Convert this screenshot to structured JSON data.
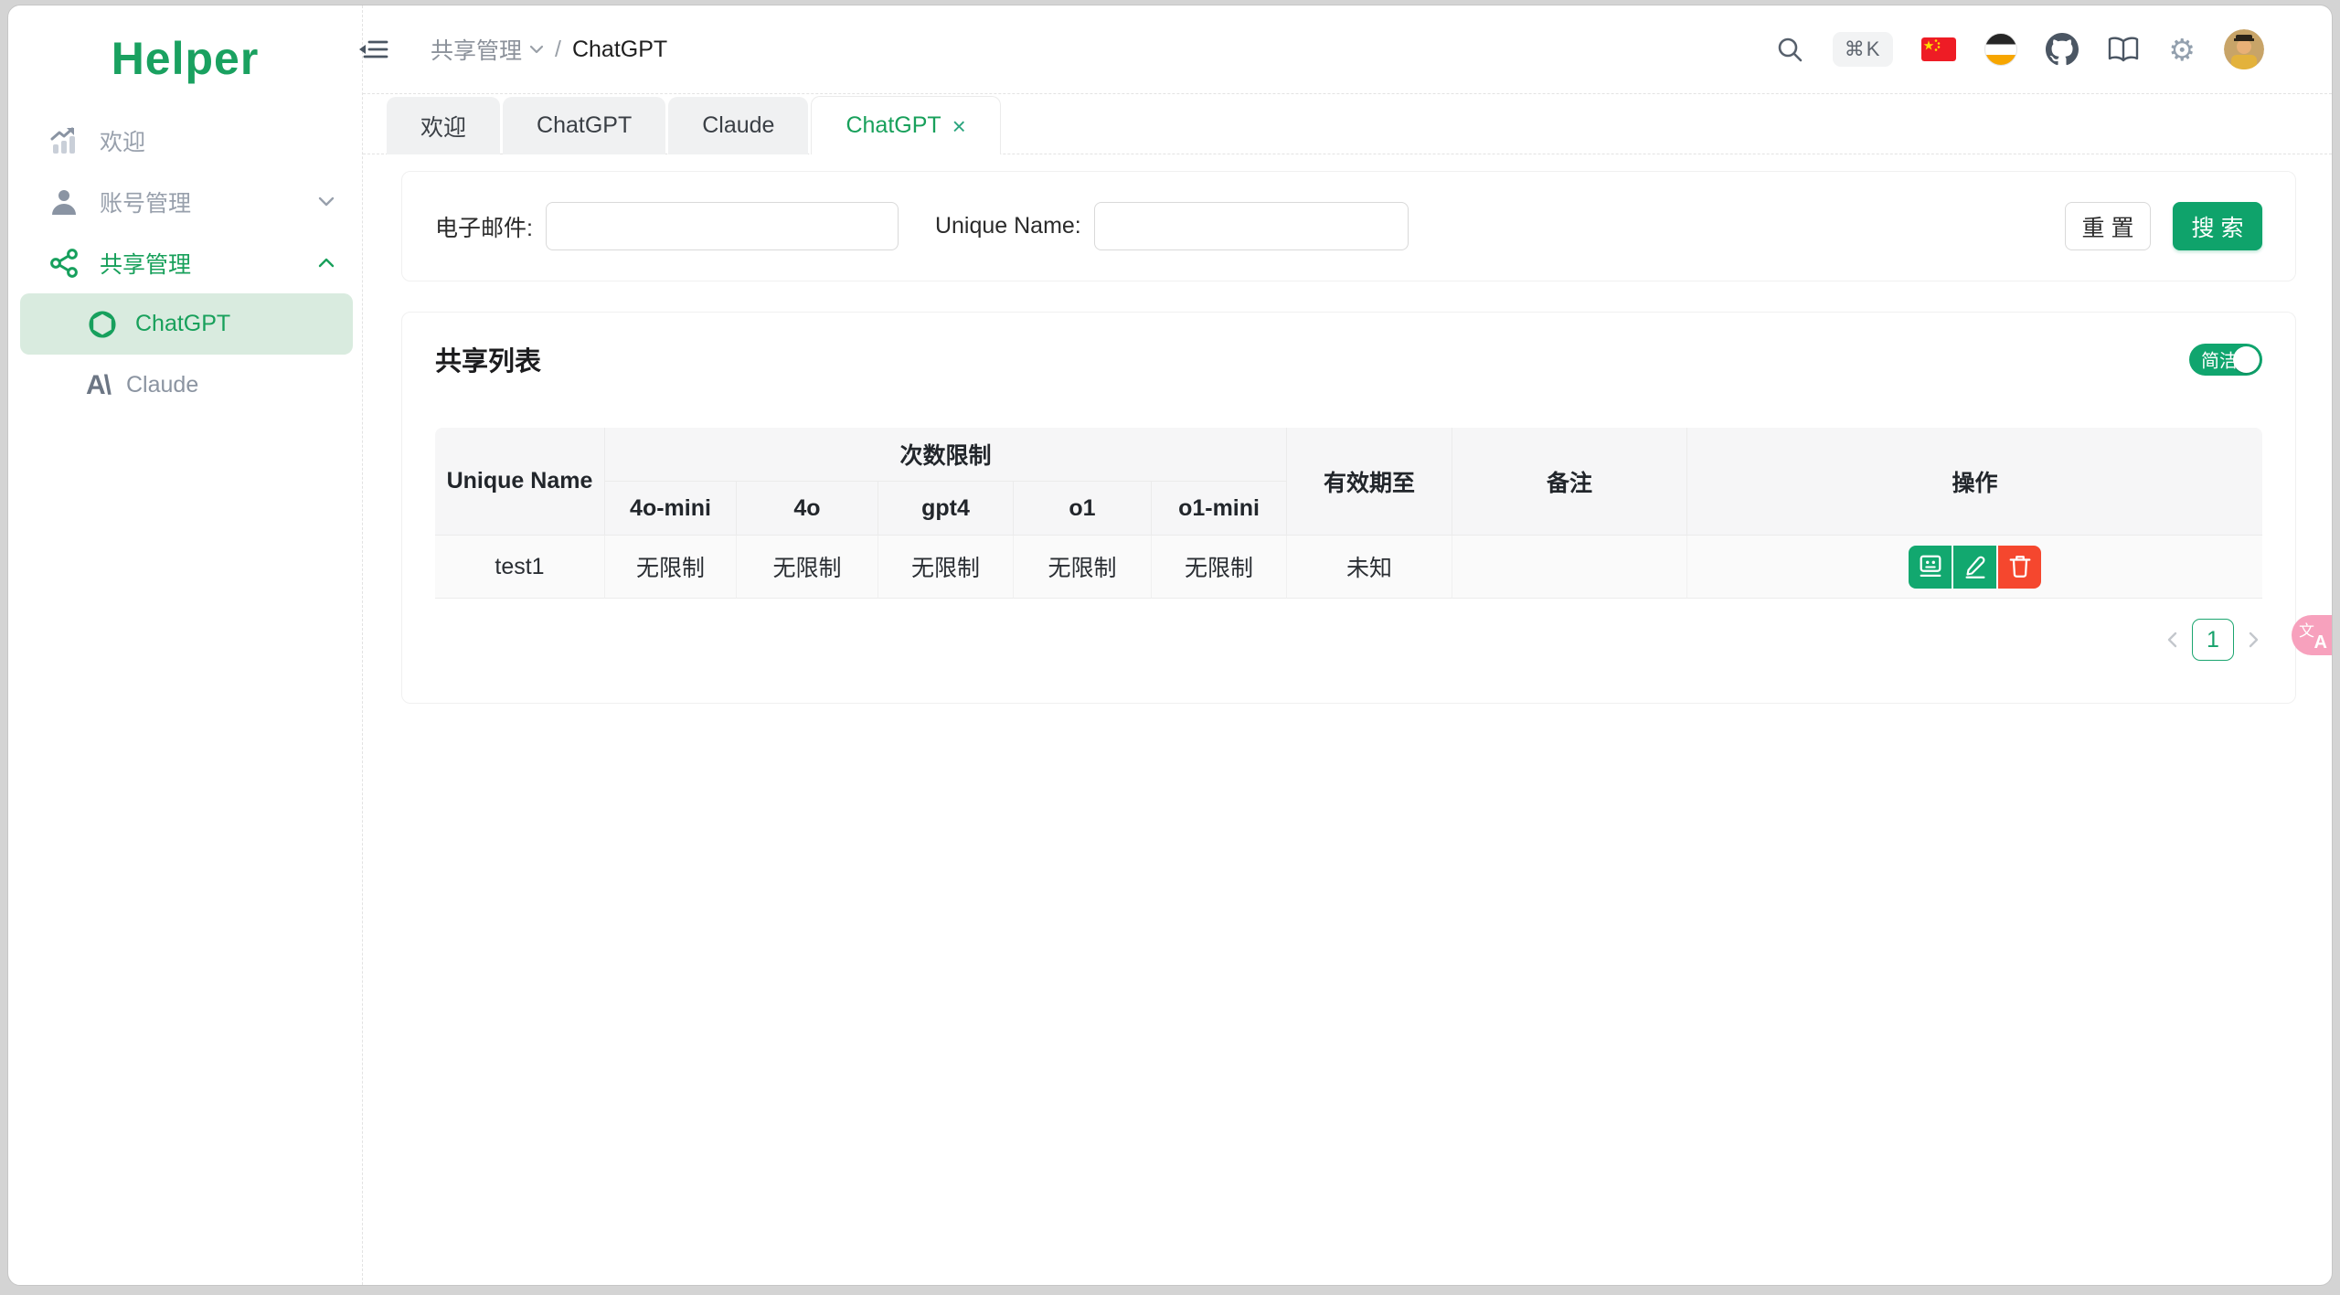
{
  "sidebar": {
    "logo": "Helper",
    "items": [
      {
        "label": "欢迎"
      },
      {
        "label": "账号管理"
      },
      {
        "label": "共享管理",
        "children": [
          {
            "label": "ChatGPT"
          },
          {
            "label": "Claude"
          }
        ]
      }
    ],
    "claude_logo_glyph": "A\\"
  },
  "header": {
    "breadcrumb": {
      "section": "共享管理",
      "separator": "/",
      "page": "ChatGPT"
    },
    "shortcut_badge": "⌘K"
  },
  "tabs": [
    {
      "label": "欢迎"
    },
    {
      "label": "ChatGPT"
    },
    {
      "label": "Claude"
    },
    {
      "label": "ChatGPT",
      "close": "×"
    }
  ],
  "search_form": {
    "email_label": "电子邮件:",
    "email_value": "",
    "unique_name_label": "Unique Name:",
    "unique_name_value": "",
    "reset_label": "重 置",
    "search_label": "搜 索"
  },
  "share_list": {
    "title": "共享列表",
    "toggle_label": "简洁",
    "toggle_on": true,
    "table": {
      "col_unique_name": "Unique Name",
      "group_limits": "次数限制",
      "sub_columns": [
        "4o-mini",
        "4o",
        "gpt4",
        "o1",
        "o1-mini"
      ],
      "col_expiry": "有效期至",
      "col_note": "备注",
      "col_actions": "操作",
      "rows": [
        {
          "unique_name": "test1",
          "limits": [
            "无限制",
            "无限制",
            "无限制",
            "无限制",
            "无限制"
          ],
          "expiry": "未知",
          "note": ""
        }
      ]
    },
    "pagination": {
      "page": "1"
    }
  },
  "float_button": {
    "zh_glyph": "文",
    "en_glyph": "A"
  },
  "colors": {
    "accent_green": "#0fa36b",
    "selected_item_bg": "#d9ebdf",
    "logo_green": "#1aa160",
    "delete_red": "#f5472e",
    "translate_pink": "#f7a1bd"
  }
}
